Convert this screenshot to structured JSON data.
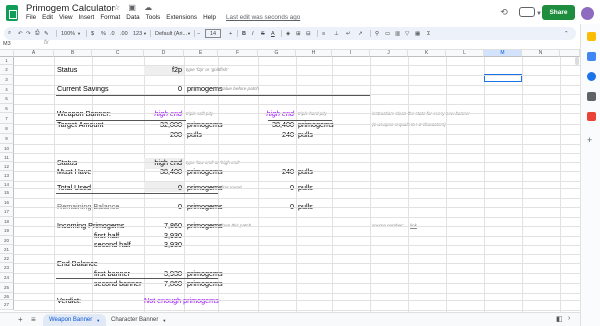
{
  "app": {
    "title": "Primogem Calculator",
    "title_icons": "☆ ▣ ☁",
    "last_edit": "Last edit was seconds ago",
    "share_label": "Share"
  },
  "menu": [
    "File",
    "Edit",
    "View",
    "Insert",
    "Format",
    "Data",
    "Tools",
    "Extensions",
    "Help"
  ],
  "toolbar": {
    "zoom": "100%",
    "currency": "$",
    "percent": "%",
    "dec_dec": ".0",
    "dec_inc": ".00",
    "number_format": "123",
    "font": "Default (Ari...",
    "font_size": "14",
    "bold": "B",
    "italic": "I",
    "strike": "S",
    "text_color": "A"
  },
  "formula_bar": {
    "name_box": "M3",
    "fx": "fx"
  },
  "columns": [
    "A",
    "B",
    "C",
    "D",
    "E",
    "F",
    "G",
    "H",
    "I",
    "J",
    "K",
    "L",
    "M",
    "N"
  ],
  "rows": [
    "1",
    "2",
    "3",
    "4",
    "5",
    "6",
    "7",
    "8",
    "9",
    "10",
    "11",
    "12",
    "13",
    "14",
    "15",
    "16",
    "17",
    "18",
    "19",
    "20",
    "21",
    "22",
    "23",
    "24",
    "25",
    "26",
    "27"
  ],
  "cells": {
    "status_label": "Status",
    "status_value": "f2p",
    "status_note": "type 'f2p' or 'goldfish'",
    "savings_label": "Current Savings",
    "savings_value": "0",
    "savings_unit": "primogems",
    "savings_note": "value before patch",
    "weapon_banner_label": "Weapon Banner:",
    "weapon_high_end_1": "high end",
    "weapon_note_1": "triple soft pity",
    "weapon_high_end_2": "high end",
    "weapon_note_2": "triple hard pity",
    "instruction_note": "instruction: clean the state for every new banner",
    "target_label": "Target Amount",
    "target_value_1": "32,000",
    "target_unit_1": "primogems",
    "target_value_2": "38,400",
    "target_unit_2": "primogems",
    "weapon_equals_note": "(1 weapon requals to< 2 characters)",
    "pulls_value_1": "200",
    "pulls_unit_1": "pulls",
    "pulls_value_2": "240",
    "pulls_unit_2": "pulls",
    "status2_label": "Status",
    "status2_value": "high end",
    "status2_note": "type 'low end' or 'high end'",
    "must_have_label": "Must Have",
    "must_have_value": "38,400",
    "must_have_unit": "primogems",
    "must_have_pulls": "240",
    "must_have_pulls_unit": "pulls",
    "total_used_label": "Total Used",
    "total_used_value": "0",
    "total_used_unit": "primogems",
    "total_used_note": "first round",
    "total_used_pulls": "0",
    "total_used_pulls_unit": "pulls",
    "remaining_label": "Remaining Balance",
    "remaining_value": "0",
    "remaining_unit": "primogems",
    "remaining_pulls": "0",
    "remaining_pulls_unit": "pulls",
    "incoming_label": "Incoming Primogems",
    "incoming_value": "7,860",
    "incoming_unit": "primogems",
    "incoming_note": "from this patch",
    "source_note": "source number:",
    "source_link": "link",
    "first_half_label": "first half",
    "first_half_value": "3,930",
    "second_half_label": "second half",
    "second_half_value": "3,930",
    "end_balance_label": "End Balance",
    "first_banner_label": "first banner",
    "first_banner_value": "3,930",
    "first_banner_unit": "primogems",
    "second_banner_label": "second banner",
    "second_banner_value": "7,860",
    "second_banner_unit": "primogems",
    "verdict_label": "Verdict:",
    "verdict_value": "Not enough primogems"
  },
  "sheets": {
    "add": "+",
    "all": "≡",
    "tabs": [
      "Weapon Banner",
      "Character Banner"
    ],
    "active": "Weapon Banner"
  },
  "colors": {
    "purple": "#9900ff",
    "share_green": "#1e8e3e",
    "selection_blue": "#1a73e8"
  }
}
